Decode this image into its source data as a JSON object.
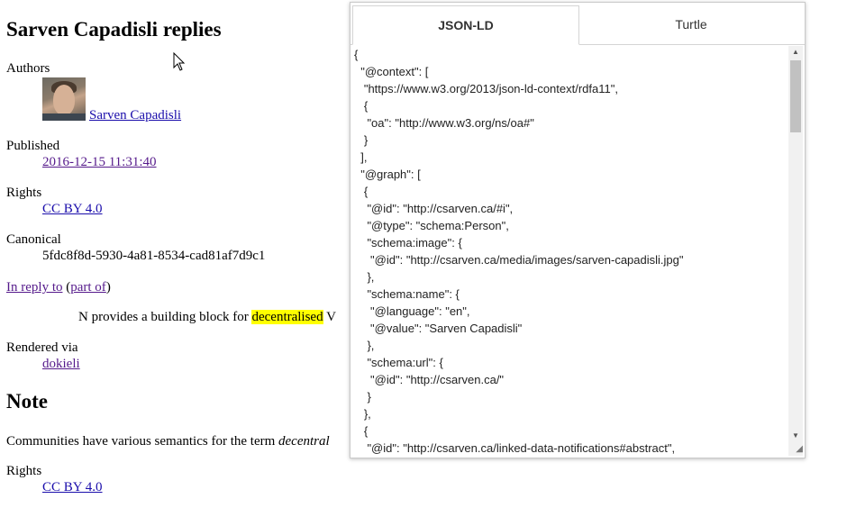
{
  "article": {
    "title": "Sarven Capadisli replies",
    "authors_label": "Authors",
    "author_name": "Sarven Capadisli",
    "published_label": "Published",
    "published_value": "2016-12-15 11:31:40",
    "rights_label": "Rights",
    "rights_value": "CC BY 4.0",
    "canonical_label": "Canonical",
    "canonical_value": "5fdc8f8d-5930-4a81-8534-cad81af7d9c1",
    "in_reply_to": "In reply to",
    "paren_open": "(",
    "part_of": "part of",
    "paren_close": ")",
    "quote_before": "N provides a building block for ",
    "quote_highlight": "decentralised",
    "quote_after": " V",
    "rendered_label": "Rendered via",
    "rendered_value": "dokieli",
    "note_heading": "Note",
    "note_text_before": "Communities have various semantics for the term ",
    "note_text_em": "decentral",
    "note_rights_label": "Rights",
    "note_rights_value": "CC BY 4.0"
  },
  "panel": {
    "tabs": [
      {
        "label": "JSON-LD",
        "active": true
      },
      {
        "label": "Turtle",
        "active": false
      }
    ],
    "code_lines": [
      "{",
      "  \"@context\": [",
      "   \"https://www.w3.org/2013/json-ld-context/rdfa11\",",
      "   {",
      "    \"oa\": \"http://www.w3.org/ns/oa#\"",
      "   }",
      "  ],",
      "  \"@graph\": [",
      "   {",
      "    \"@id\": \"http://csarven.ca/#i\",",
      "    \"@type\": \"schema:Person\",",
      "    \"schema:image\": {",
      "     \"@id\": \"http://csarven.ca/media/images/sarven-capadisli.jpg\"",
      "    },",
      "    \"schema:name\": {",
      "     \"@language\": \"en\",",
      "     \"@value\": \"Sarven Capadisli\"",
      "    },",
      "    \"schema:url\": {",
      "     \"@id\": \"http://csarven.ca/\"",
      "    }",
      "   },",
      "   {",
      "    \"@id\": \"http://csarven.ca/linked-data-notifications#abstract\","
    ],
    "scroll_up_icon": "▲",
    "scroll_down_icon": "▼",
    "resize_icon": "◢"
  }
}
